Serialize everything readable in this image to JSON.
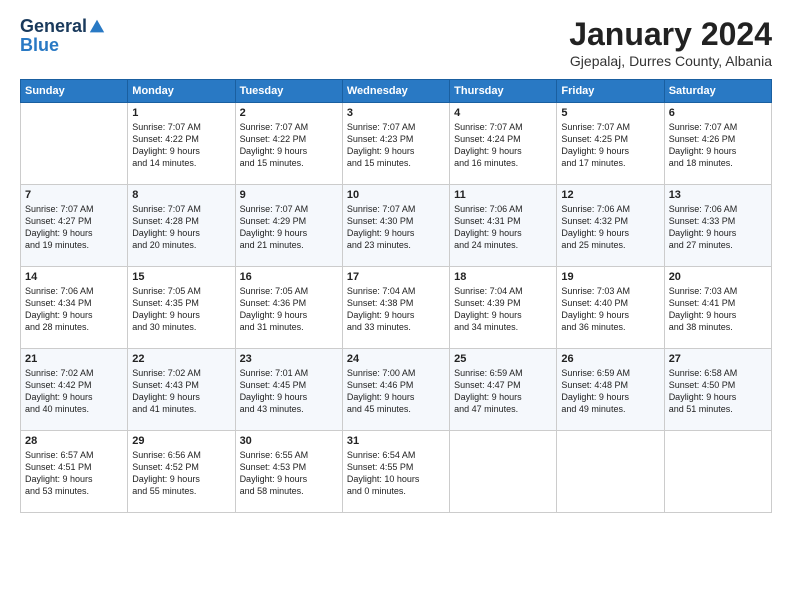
{
  "header": {
    "logo_general": "General",
    "logo_blue": "Blue",
    "month": "January 2024",
    "location": "Gjepalaj, Durres County, Albania"
  },
  "days_of_week": [
    "Sunday",
    "Monday",
    "Tuesday",
    "Wednesday",
    "Thursday",
    "Friday",
    "Saturday"
  ],
  "weeks": [
    [
      {
        "day": "",
        "info": ""
      },
      {
        "day": "1",
        "info": "Sunrise: 7:07 AM\nSunset: 4:22 PM\nDaylight: 9 hours\nand 14 minutes."
      },
      {
        "day": "2",
        "info": "Sunrise: 7:07 AM\nSunset: 4:22 PM\nDaylight: 9 hours\nand 15 minutes."
      },
      {
        "day": "3",
        "info": "Sunrise: 7:07 AM\nSunset: 4:23 PM\nDaylight: 9 hours\nand 15 minutes."
      },
      {
        "day": "4",
        "info": "Sunrise: 7:07 AM\nSunset: 4:24 PM\nDaylight: 9 hours\nand 16 minutes."
      },
      {
        "day": "5",
        "info": "Sunrise: 7:07 AM\nSunset: 4:25 PM\nDaylight: 9 hours\nand 17 minutes."
      },
      {
        "day": "6",
        "info": "Sunrise: 7:07 AM\nSunset: 4:26 PM\nDaylight: 9 hours\nand 18 minutes."
      }
    ],
    [
      {
        "day": "7",
        "info": "Sunrise: 7:07 AM\nSunset: 4:27 PM\nDaylight: 9 hours\nand 19 minutes."
      },
      {
        "day": "8",
        "info": "Sunrise: 7:07 AM\nSunset: 4:28 PM\nDaylight: 9 hours\nand 20 minutes."
      },
      {
        "day": "9",
        "info": "Sunrise: 7:07 AM\nSunset: 4:29 PM\nDaylight: 9 hours\nand 21 minutes."
      },
      {
        "day": "10",
        "info": "Sunrise: 7:07 AM\nSunset: 4:30 PM\nDaylight: 9 hours\nand 23 minutes."
      },
      {
        "day": "11",
        "info": "Sunrise: 7:06 AM\nSunset: 4:31 PM\nDaylight: 9 hours\nand 24 minutes."
      },
      {
        "day": "12",
        "info": "Sunrise: 7:06 AM\nSunset: 4:32 PM\nDaylight: 9 hours\nand 25 minutes."
      },
      {
        "day": "13",
        "info": "Sunrise: 7:06 AM\nSunset: 4:33 PM\nDaylight: 9 hours\nand 27 minutes."
      }
    ],
    [
      {
        "day": "14",
        "info": "Sunrise: 7:06 AM\nSunset: 4:34 PM\nDaylight: 9 hours\nand 28 minutes."
      },
      {
        "day": "15",
        "info": "Sunrise: 7:05 AM\nSunset: 4:35 PM\nDaylight: 9 hours\nand 30 minutes."
      },
      {
        "day": "16",
        "info": "Sunrise: 7:05 AM\nSunset: 4:36 PM\nDaylight: 9 hours\nand 31 minutes."
      },
      {
        "day": "17",
        "info": "Sunrise: 7:04 AM\nSunset: 4:38 PM\nDaylight: 9 hours\nand 33 minutes."
      },
      {
        "day": "18",
        "info": "Sunrise: 7:04 AM\nSunset: 4:39 PM\nDaylight: 9 hours\nand 34 minutes."
      },
      {
        "day": "19",
        "info": "Sunrise: 7:03 AM\nSunset: 4:40 PM\nDaylight: 9 hours\nand 36 minutes."
      },
      {
        "day": "20",
        "info": "Sunrise: 7:03 AM\nSunset: 4:41 PM\nDaylight: 9 hours\nand 38 minutes."
      }
    ],
    [
      {
        "day": "21",
        "info": "Sunrise: 7:02 AM\nSunset: 4:42 PM\nDaylight: 9 hours\nand 40 minutes."
      },
      {
        "day": "22",
        "info": "Sunrise: 7:02 AM\nSunset: 4:43 PM\nDaylight: 9 hours\nand 41 minutes."
      },
      {
        "day": "23",
        "info": "Sunrise: 7:01 AM\nSunset: 4:45 PM\nDaylight: 9 hours\nand 43 minutes."
      },
      {
        "day": "24",
        "info": "Sunrise: 7:00 AM\nSunset: 4:46 PM\nDaylight: 9 hours\nand 45 minutes."
      },
      {
        "day": "25",
        "info": "Sunrise: 6:59 AM\nSunset: 4:47 PM\nDaylight: 9 hours\nand 47 minutes."
      },
      {
        "day": "26",
        "info": "Sunrise: 6:59 AM\nSunset: 4:48 PM\nDaylight: 9 hours\nand 49 minutes."
      },
      {
        "day": "27",
        "info": "Sunrise: 6:58 AM\nSunset: 4:50 PM\nDaylight: 9 hours\nand 51 minutes."
      }
    ],
    [
      {
        "day": "28",
        "info": "Sunrise: 6:57 AM\nSunset: 4:51 PM\nDaylight: 9 hours\nand 53 minutes."
      },
      {
        "day": "29",
        "info": "Sunrise: 6:56 AM\nSunset: 4:52 PM\nDaylight: 9 hours\nand 55 minutes."
      },
      {
        "day": "30",
        "info": "Sunrise: 6:55 AM\nSunset: 4:53 PM\nDaylight: 9 hours\nand 58 minutes."
      },
      {
        "day": "31",
        "info": "Sunrise: 6:54 AM\nSunset: 4:55 PM\nDaylight: 10 hours\nand 0 minutes."
      },
      {
        "day": "",
        "info": ""
      },
      {
        "day": "",
        "info": ""
      },
      {
        "day": "",
        "info": ""
      }
    ]
  ]
}
